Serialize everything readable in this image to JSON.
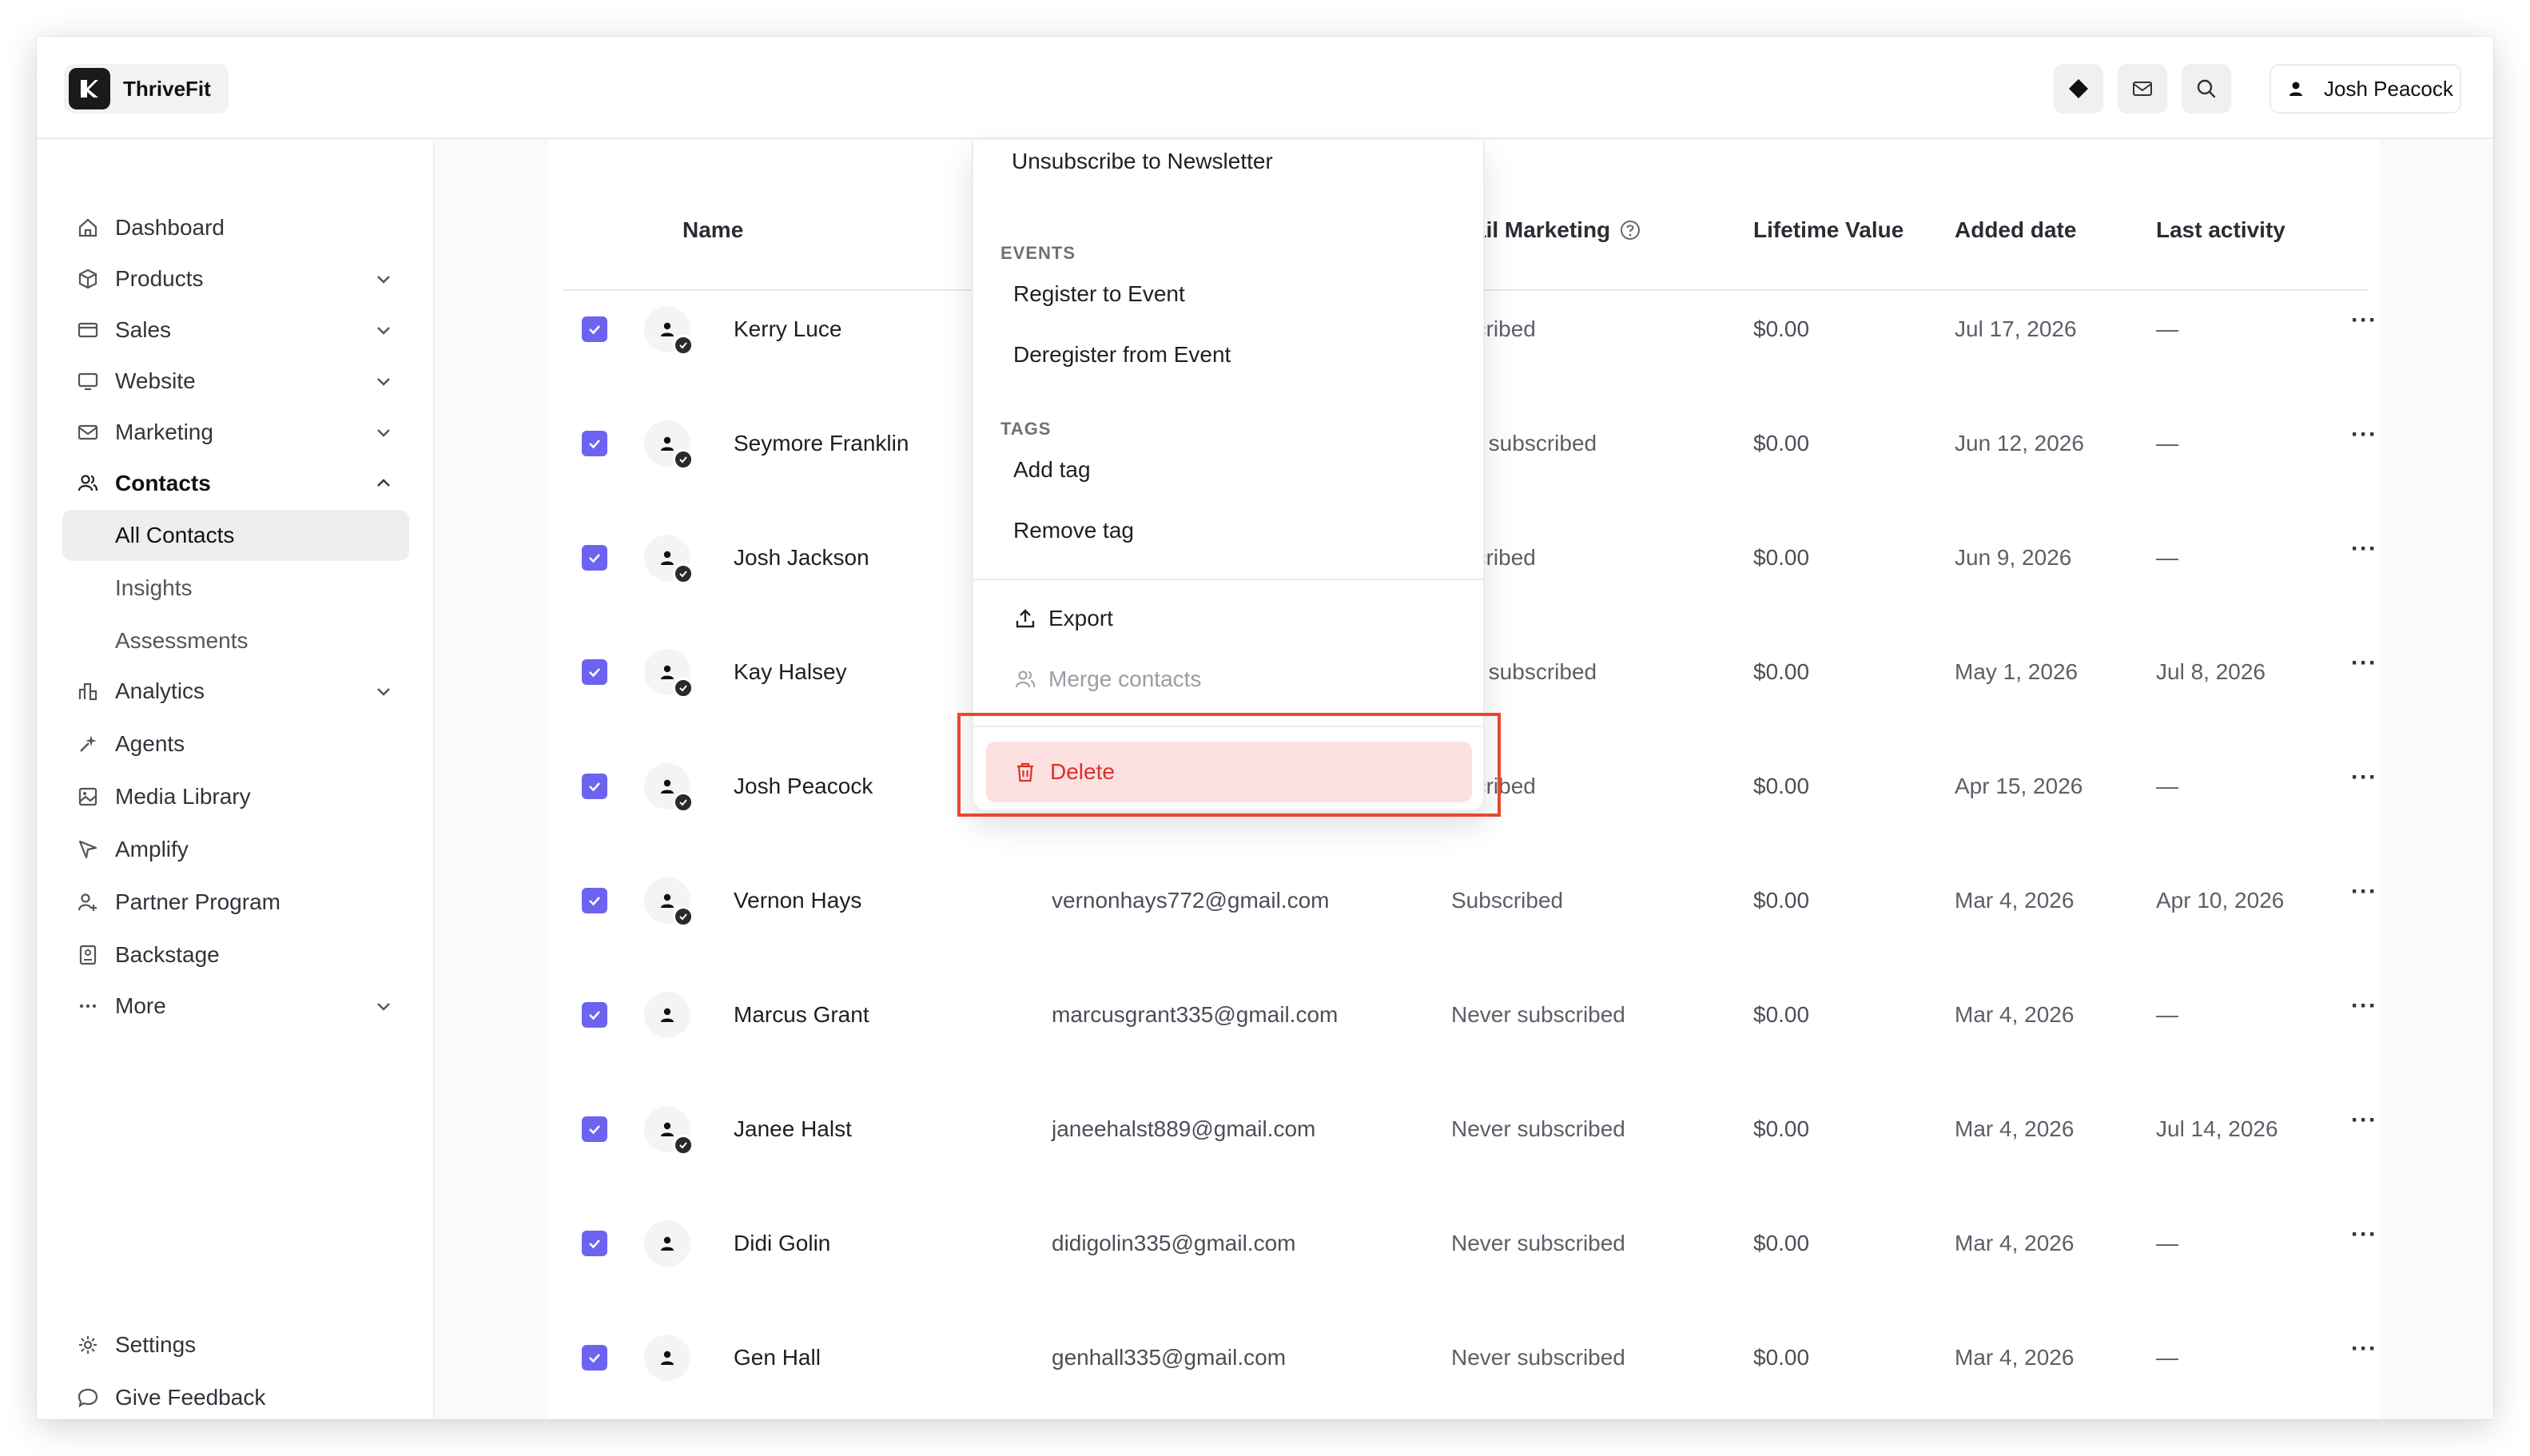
{
  "app": {
    "brand_name": "ThriveFit",
    "user_name": "Josh Peacock"
  },
  "header": {
    "icons": [
      "diamond-icon",
      "mail-icon",
      "search-icon"
    ]
  },
  "sidebar": {
    "items": [
      {
        "label": "Dashboard",
        "icon": "home-icon"
      },
      {
        "label": "Products",
        "icon": "box-icon"
      },
      {
        "label": "Sales",
        "icon": "card-icon"
      },
      {
        "label": "Website",
        "icon": "monitor-icon"
      },
      {
        "label": "Marketing",
        "icon": "mail-icon"
      },
      {
        "label": "Contacts",
        "icon": "users-icon"
      },
      {
        "label": "Analytics",
        "icon": "bar-chart-icon"
      },
      {
        "label": "Agents",
        "icon": "sparkle-icon"
      },
      {
        "label": "Media Library",
        "icon": "image-icon"
      },
      {
        "label": "Amplify",
        "icon": "send-icon"
      },
      {
        "label": "Partner Program",
        "icon": "partner-icon"
      },
      {
        "label": "Backstage",
        "icon": "backstage-icon"
      },
      {
        "label": "More",
        "icon": "dots-icon"
      }
    ],
    "contacts_sub": [
      "All Contacts",
      "Insights",
      "Assessments"
    ],
    "footer": [
      {
        "label": "Settings",
        "icon": "gear-icon"
      },
      {
        "label": "Give Feedback",
        "icon": "chat-icon"
      }
    ]
  },
  "table": {
    "headers": {
      "name": "Name",
      "email_marketing": "ail Marketing",
      "lifetime_value": "Lifetime Value",
      "added_date": "Added date",
      "last_activity": "Last activity"
    },
    "rows": [
      {
        "name": "Kerry Luce",
        "email": "",
        "status": "bscribed",
        "value": "$0.00",
        "added": "Jul 17, 2026",
        "last": "—",
        "verified": true
      },
      {
        "name": "Seymore Franklin",
        "email": "",
        "status": "ver subscribed",
        "value": "$0.00",
        "added": "Jun 12, 2026",
        "last": "—",
        "verified": true
      },
      {
        "name": "Josh Jackson",
        "email": "",
        "status": "bscribed",
        "value": "$0.00",
        "added": "Jun 9, 2026",
        "last": "—",
        "verified": true
      },
      {
        "name": "Kay Halsey",
        "email": "",
        "status": "ver subscribed",
        "value": "$0.00",
        "added": "May 1, 2026",
        "last": "Jul 8, 2026",
        "verified": true
      },
      {
        "name": "Josh Peacock",
        "email": "",
        "status": "bscribed",
        "value": "$0.00",
        "added": "Apr 15, 2026",
        "last": "—",
        "verified": true
      },
      {
        "name": "Vernon Hays",
        "email": "vernonhays772@gmail.com",
        "status": "Subscribed",
        "value": "$0.00",
        "added": "Mar 4, 2026",
        "last": "Apr 10, 2026",
        "verified": true
      },
      {
        "name": "Marcus Grant",
        "email": "marcusgrant335@gmail.com",
        "status": "Never subscribed",
        "value": "$0.00",
        "added": "Mar 4, 2026",
        "last": "—",
        "verified": false
      },
      {
        "name": "Janee Halst",
        "email": "janeehalst889@gmail.com",
        "status": "Never subscribed",
        "value": "$0.00",
        "added": "Mar 4, 2026",
        "last": "Jul 14, 2026",
        "verified": true
      },
      {
        "name": "Didi Golin",
        "email": "didigolin335@gmail.com",
        "status": "Never subscribed",
        "value": "$0.00",
        "added": "Mar 4, 2026",
        "last": "—",
        "verified": false
      },
      {
        "name": "Gen Hall",
        "email": "genhall335@gmail.com",
        "status": "Never subscribed",
        "value": "$0.00",
        "added": "Mar 4, 2026",
        "last": "—",
        "verified": false
      }
    ]
  },
  "menu": {
    "top_item": "Unsubscribe to Newsletter",
    "events_label": "EVENTS",
    "register": "Register to Event",
    "deregister": "Deregister from Event",
    "tags_label": "TAGS",
    "add_tag": "Add tag",
    "remove_tag": "Remove tag",
    "export": "Export",
    "merge": "Merge contacts",
    "delete": "Delete"
  },
  "colors": {
    "accent": "#6c63f0",
    "danger": "#d9312b",
    "danger_bg": "#fde0e0",
    "highlight": "#e8482f"
  }
}
